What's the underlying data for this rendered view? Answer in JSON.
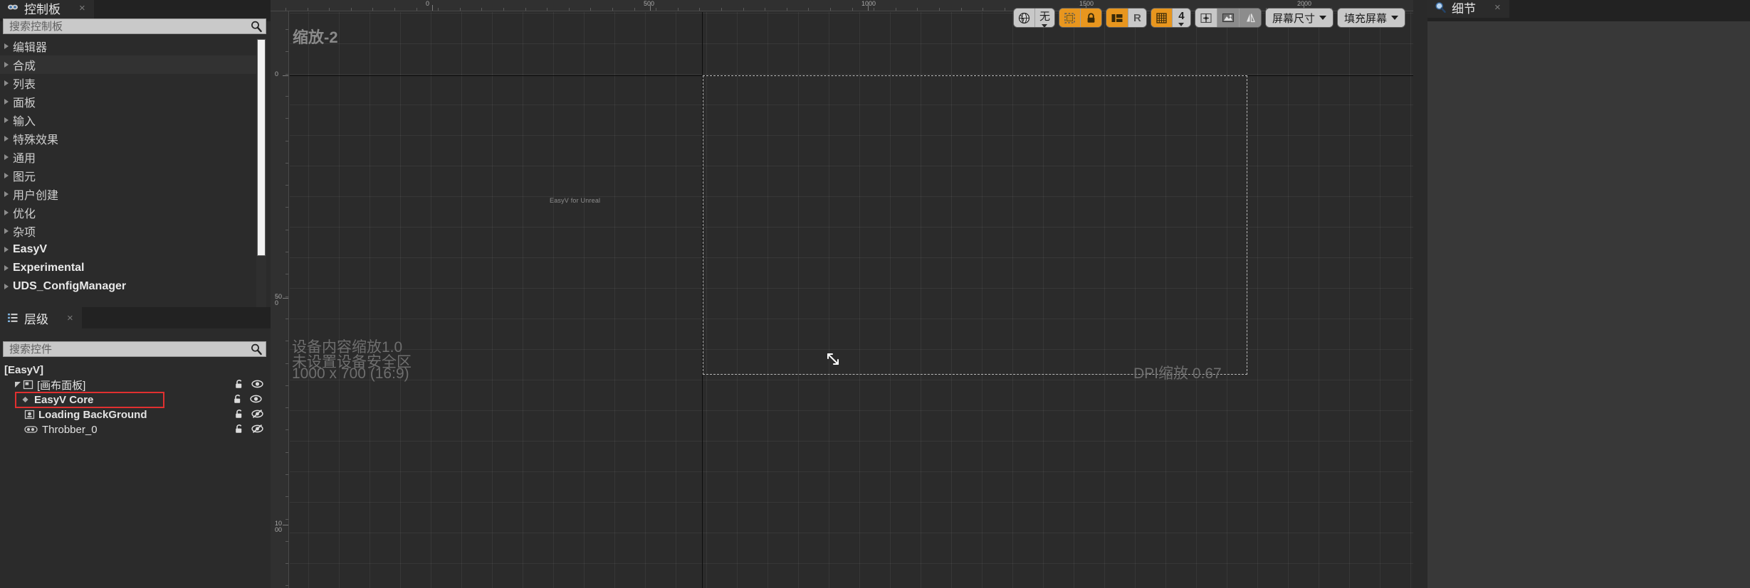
{
  "app": {
    "engine": "Unreal Engine UMG Widget Designer"
  },
  "palette": {
    "tab_label": "控制板",
    "tab_icon": "palette-icon",
    "tab_close": "×",
    "search_placeholder": "搜索控制板",
    "search_value": "",
    "items": [
      {
        "label": "编辑器",
        "bold": false,
        "highlight": false
      },
      {
        "label": "合成",
        "bold": false,
        "highlight": true
      },
      {
        "label": "列表",
        "bold": false,
        "highlight": false
      },
      {
        "label": "面板",
        "bold": false,
        "highlight": false
      },
      {
        "label": "输入",
        "bold": false,
        "highlight": false
      },
      {
        "label": "特殊效果",
        "bold": false,
        "highlight": false
      },
      {
        "label": "通用",
        "bold": false,
        "highlight": false
      },
      {
        "label": "图元",
        "bold": false,
        "highlight": false
      },
      {
        "label": "用户创建",
        "bold": false,
        "highlight": false
      },
      {
        "label": "优化",
        "bold": false,
        "highlight": false
      },
      {
        "label": "杂项",
        "bold": false,
        "highlight": false
      },
      {
        "label": "EasyV",
        "bold": true,
        "highlight": false
      },
      {
        "label": "Experimental",
        "bold": true,
        "highlight": false
      },
      {
        "label": "UDS_ConfigManager",
        "bold": true,
        "highlight": false
      }
    ]
  },
  "hierarchy": {
    "tab_label": "层级",
    "tab_icon": "hierarchy-icon",
    "tab_close": "×",
    "search_placeholder": "搜索控件",
    "search_value": "",
    "nodes": [
      {
        "label": "[EasyV]",
        "indent": 0,
        "bold": true,
        "expander": "none",
        "icon": "none",
        "lock": false,
        "eye": null,
        "selected": false
      },
      {
        "label": "[画布面板]",
        "indent": 1,
        "bold": false,
        "expander": "expanded",
        "icon": "canvas-panel-icon",
        "lock": true,
        "eye": "visible",
        "selected": false
      },
      {
        "label": "EasyV Core",
        "indent": 2,
        "bold": true,
        "expander": "none",
        "icon": "widget-diamond-icon",
        "lock": true,
        "eye": "visible",
        "selected": true
      },
      {
        "label": "Loading BackGround",
        "indent": 2,
        "bold": true,
        "expander": "none",
        "icon": "image-widget-icon",
        "lock": true,
        "eye": "hidden",
        "selected": false
      },
      {
        "label": "Throbber_0",
        "indent": 2,
        "bold": false,
        "expander": "none",
        "icon": "throbber-icon",
        "lock": true,
        "eye": "hidden",
        "selected": false
      }
    ],
    "selection_outline_color": "#e03030"
  },
  "viewport": {
    "zoom_label": "缩放-2",
    "canvas_center_text": "EasyV for Unreal",
    "notes": [
      "设备内容缩放1.0",
      "未设置设备安全区",
      "1000 x 700 (16:9)"
    ],
    "dpi_note": "DPI缩放 0.67",
    "cursor": "resize-nwse-cursor",
    "ruler_top": {
      "labels": [
        "0",
        "500",
        "1000",
        "1500",
        "2000"
      ],
      "positions": [
        607,
        913,
        1219,
        1525,
        1831
      ]
    },
    "ruler_left": {
      "labels": [
        "0",
        "500",
        "1000"
      ],
      "positions": [
        106,
        419,
        738
      ]
    },
    "toolbar": {
      "groups": [
        {
          "name": "localization-group",
          "buttons": [
            {
              "name": "globe-icon",
              "label": "",
              "glyph": "globe",
              "state": "off",
              "dropdown": false
            },
            {
              "name": "localization-none",
              "label": "无",
              "glyph": "text",
              "state": "off",
              "dropdown": true
            }
          ]
        },
        {
          "name": "selection-group",
          "buttons": [
            {
              "name": "dashed-outline-toggle",
              "label": "",
              "glyph": "dashed-square",
              "state": "on",
              "dropdown": false
            },
            {
              "name": "lock-toggle",
              "label": "",
              "glyph": "lock",
              "state": "on",
              "dropdown": false
            }
          ]
        },
        {
          "name": "layout-group",
          "buttons": [
            {
              "name": "layout-toggle",
              "label": "",
              "glyph": "layout",
              "state": "on",
              "dropdown": false
            },
            {
              "name": "respect-toggle",
              "label": "R",
              "glyph": "text",
              "state": "off",
              "dropdown": false
            }
          ]
        },
        {
          "name": "grid-group",
          "buttons": [
            {
              "name": "grid-snap-toggle",
              "label": "",
              "glyph": "grid",
              "state": "on",
              "dropdown": false
            },
            {
              "name": "grid-size-value",
              "label": "4",
              "glyph": "text",
              "state": "off",
              "dropdown": true
            }
          ]
        },
        {
          "name": "guide-group",
          "buttons": [
            {
              "name": "transform-handles-toggle",
              "label": "",
              "glyph": "transform",
              "state": "off",
              "dropdown": false
            },
            {
              "name": "preview-image-toggle",
              "label": "",
              "glyph": "image",
              "state": "dark",
              "dropdown": false
            },
            {
              "name": "outline-toggle",
              "label": "",
              "glyph": "outline",
              "state": "dark",
              "dropdown": false
            }
          ]
        },
        {
          "name": "screen-size-group",
          "buttons": [
            {
              "name": "screen-size-dropdown",
              "label": "屏幕尺寸",
              "glyph": "text",
              "state": "off",
              "dropdown": true
            }
          ]
        },
        {
          "name": "fill-screen-group",
          "buttons": [
            {
              "name": "fill-screen-dropdown",
              "label": "填充屏幕",
              "glyph": "text",
              "state": "off",
              "dropdown": true
            }
          ]
        }
      ]
    }
  },
  "details": {
    "tab_label": "细节",
    "tab_icon": "details-search-icon",
    "tab_close": "×"
  }
}
